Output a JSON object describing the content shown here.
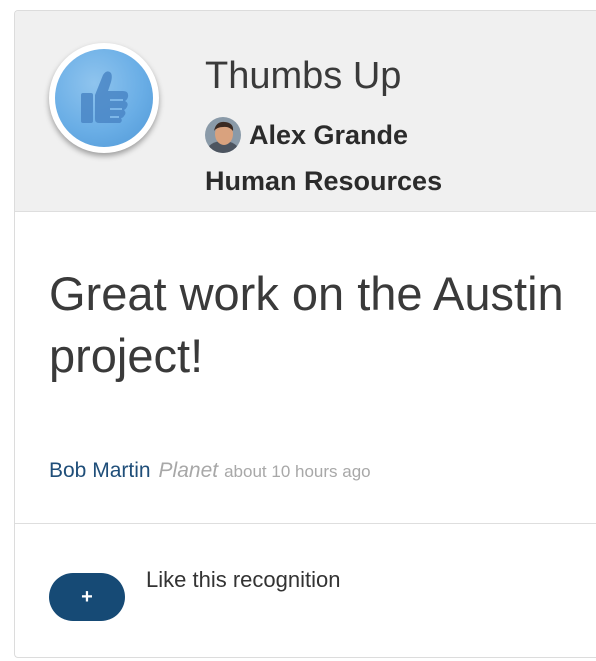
{
  "award": {
    "title": "Thumbs Up",
    "icon": "thumbs-up-icon",
    "badge_color": "#6aaee6"
  },
  "recipient": {
    "name": "Alex Grande",
    "department": "Human Resources"
  },
  "message": "Great work on the Austin project!",
  "meta": {
    "giver": "Bob Martin",
    "team": "Planet",
    "time": "about 10 hours ago"
  },
  "actions": {
    "like_symbol": "+",
    "like_label": "Like this recognition",
    "button_color": "#164a75"
  }
}
